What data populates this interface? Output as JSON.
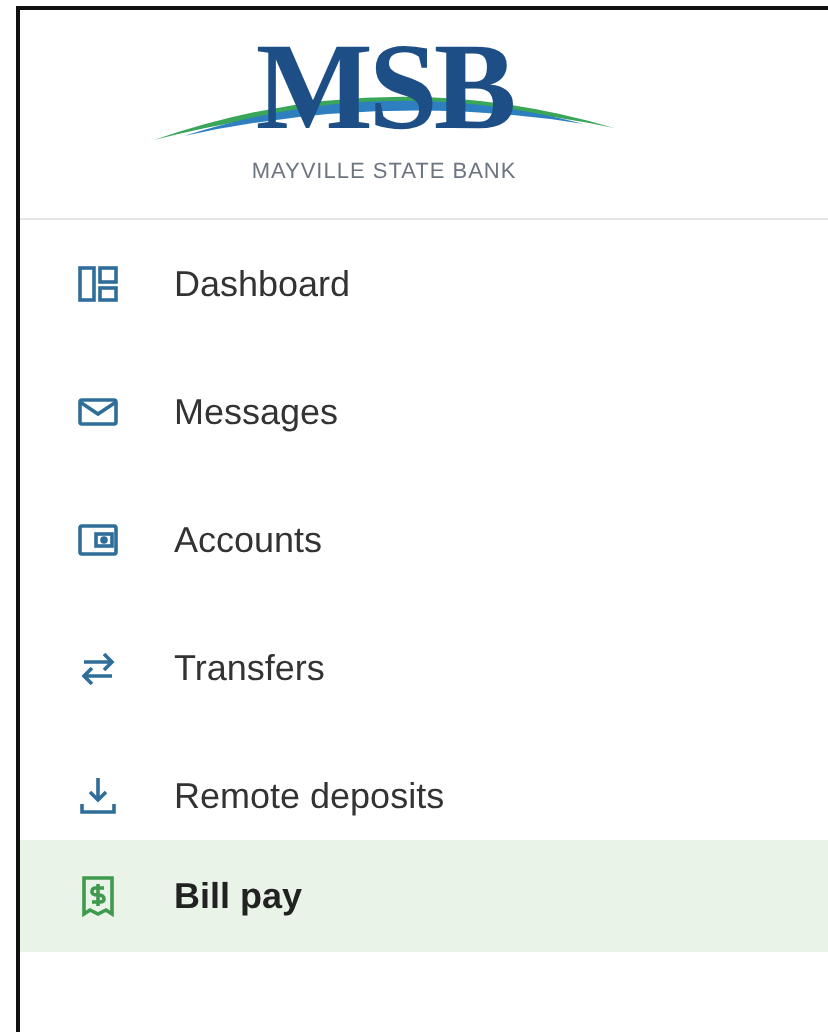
{
  "logo": {
    "initials": "MSB",
    "bank_name": "MAYVILLE STATE BANK"
  },
  "nav_items": [
    {
      "label": "Dashboard",
      "selected": false
    },
    {
      "label": "Messages",
      "selected": false
    },
    {
      "label": "Accounts",
      "selected": false
    },
    {
      "label": "Transfers",
      "selected": false
    },
    {
      "label": "Remote deposits",
      "selected": false
    },
    {
      "label": "Bill pay",
      "selected": true
    }
  ]
}
